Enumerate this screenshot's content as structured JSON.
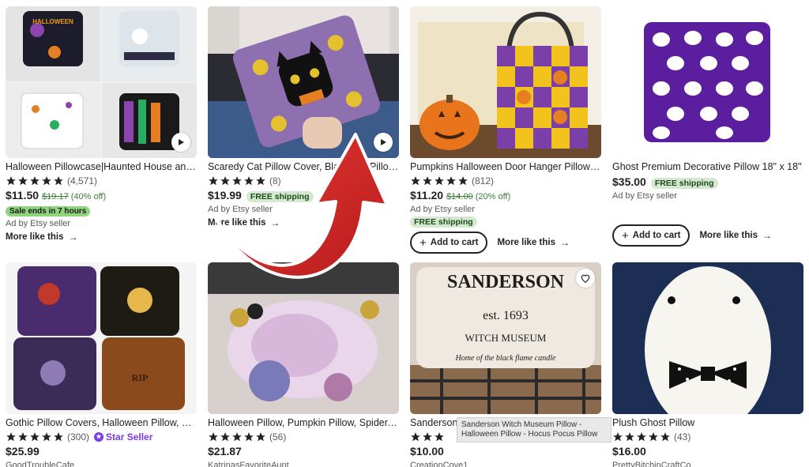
{
  "star_color": "#222222",
  "listings": [
    {
      "title": "Halloween Pillowcase|Haunted House and ...",
      "review_count": "(4,571)",
      "price": "$11.50",
      "original_price": "$19.17",
      "discount": "(40% off)",
      "sale_badge": "Sale ends in 7 hours",
      "ad_label": "Ad by Etsy seller",
      "more_like_this": "More like this"
    },
    {
      "title": "Scaredy Cat Pillow Cover, Black Cat Pillow ...",
      "review_count": "(8)",
      "price": "$19.99",
      "free_shipping": "FREE shipping",
      "ad_label": "Ad by Etsy seller",
      "more_like_this": "More like this"
    },
    {
      "title": "Pumpkins Halloween Door Hanger Pillow W...",
      "review_count": "(812)",
      "price": "$11.20",
      "original_price": "$14.00",
      "discount": "(20% off)",
      "ad_label": "Ad by Etsy seller",
      "free_shipping": "FREE shipping",
      "add_to_cart": "Add to cart",
      "more_like_this": "More like this"
    },
    {
      "title": "Ghost Premium Decorative Pillow 18\" x 18\"",
      "price": "$35.00",
      "free_shipping": "FREE shipping",
      "ad_label": "Ad by Etsy seller",
      "add_to_cart": "Add to cart",
      "more_like_this": "More like this"
    },
    {
      "title": "Gothic Pillow Covers, Halloween Pillow, De...",
      "review_count": "(300)",
      "star_seller": "Star Seller",
      "price": "$25.99",
      "shop": "GoodTroubleCafe"
    },
    {
      "title": "Halloween Pillow, Pumpkin Pillow, Spider, S...",
      "review_count": "(56)",
      "price": "$21.87",
      "shop": "KatrinasFavoriteAunt"
    },
    {
      "title": "Sanderson",
      "price": "$10.00",
      "shop": "CreationCove1",
      "image_text": {
        "line1": "SANDERSON",
        "line2": "est. 1693",
        "line3": "WITCH MUSEUM",
        "line4": "Home of the black flame candle"
      }
    },
    {
      "title": "Plush Ghost Pillow",
      "review_count": "(43)",
      "price": "$16.00",
      "shop": "PrettyBitchinCraftCo"
    }
  ],
  "thumb_text": {
    "halloween": "HALLOWEEN",
    "rip": "RIP"
  },
  "tooltip": "Sanderson Witch Museum Pillow - Halloween Pillow - Hocus Pocus Pillow"
}
